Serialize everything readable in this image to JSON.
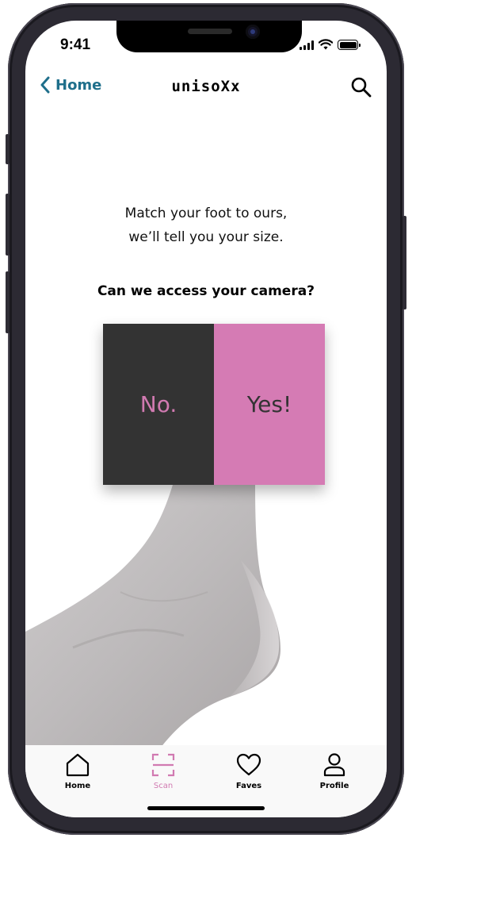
{
  "status_bar": {
    "time": "9:41"
  },
  "nav": {
    "back_label": "Home",
    "title": "unisoXx"
  },
  "content": {
    "intro_line_1": "Match your foot to ours,",
    "intro_line_2": "we’ll tell you your size.",
    "question": "Can we access your camera?",
    "no_label": "No.",
    "yes_label": "Yes!"
  },
  "tabs": [
    {
      "label": "Home",
      "icon": "home-icon",
      "active": false
    },
    {
      "label": "Scan",
      "icon": "scan-icon",
      "active": true
    },
    {
      "label": "Faves",
      "icon": "heart-icon",
      "active": false
    },
    {
      "label": "Profile",
      "icon": "user-icon",
      "active": false
    }
  ],
  "colors": {
    "accent_pink": "#d57bb4",
    "dark_gray": "#333333",
    "link_teal": "#1f6f8b"
  }
}
